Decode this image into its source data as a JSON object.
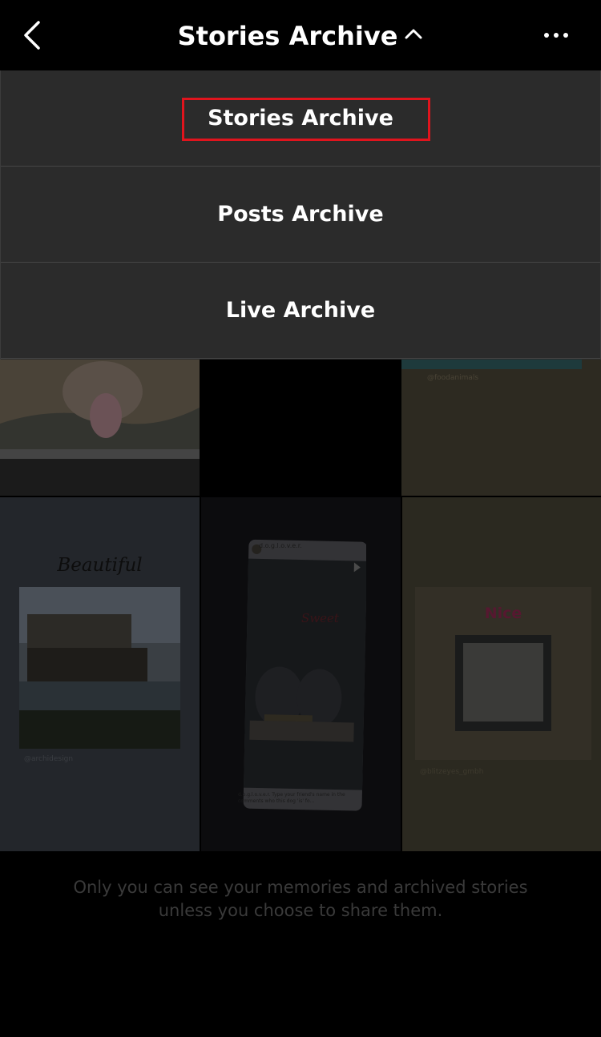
{
  "header": {
    "title": "Stories Archive",
    "back_icon": "chevron-left-icon",
    "title_chevron_icon": "chevron-up-icon",
    "more_icon": "more-horizontal-icon"
  },
  "dropdown": {
    "items": [
      {
        "label": "Stories Archive",
        "selected": true
      },
      {
        "label": "Posts Archive",
        "selected": false
      },
      {
        "label": "Live Archive",
        "selected": false
      }
    ],
    "highlight_color": "#e0141d"
  },
  "grid": {
    "tiles": [
      {
        "handle": "@foodanimals"
      },
      {
        "title": "Beautiful",
        "handle": "@archidesign"
      },
      {
        "title": "Sweet",
        "post_user": "d.o.g.l.o.v.e.r.",
        "caption": "d.o.g.l.o.v.e.r. Type your friend's name in the comments who this dog 'is' fo..."
      },
      {
        "title": "Nice",
        "handle": "@blitzeyes_gmbh"
      }
    ]
  },
  "footer": {
    "line1": "Only you can see your memories and archived stories",
    "line2": "unless you choose to share them."
  }
}
